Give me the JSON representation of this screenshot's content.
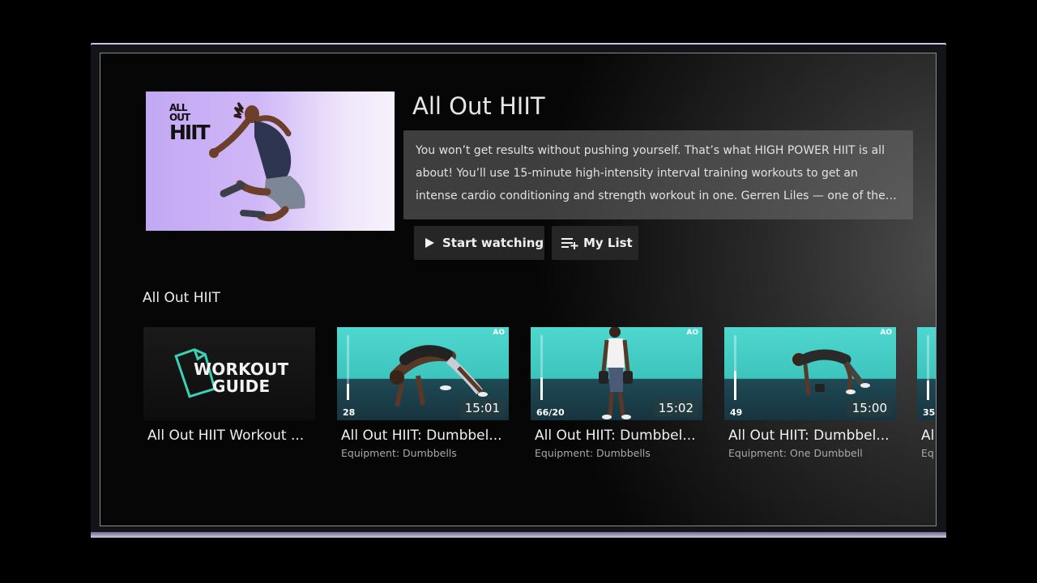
{
  "hero": {
    "logo_line1": "ALL OUT",
    "logo_line2": "HIIT",
    "title": "All Out HIIT",
    "description": "You won’t get results without pushing yourself. That’s what HIGH POWER HIIT is all about! You’ll use 15-minute high-intensity interval training workouts to get an intense cardio conditioning and strength workout in one. Gerren Liles — one of the most m...",
    "start_label": "Start watching",
    "mylist_label": "My List"
  },
  "row": {
    "title": "All Out HIIT",
    "cards": [
      {
        "title": "All Out HIIT Workout ...",
        "subtitle": "",
        "guide_line1": "WORKOUT",
        "guide_line2": "GUIDE"
      },
      {
        "title": "All Out HIIT: Dumbbel...",
        "subtitle": "Equipment: Dumbbells",
        "duration": "15:01",
        "number": "28",
        "meter_fraction": 0.25,
        "brand": "AO"
      },
      {
        "title": "All Out HIIT: Dumbbel...",
        "subtitle": "Equipment: Dumbbells",
        "duration": "15:02",
        "number": "66/20",
        "meter_fraction": 0.35,
        "brand": "AO"
      },
      {
        "title": "All Out HIIT: Dumbbel...",
        "subtitle": "Equipment: One Dumbbell",
        "duration": "15:00",
        "number": "49",
        "meter_fraction": 0.45,
        "brand": "AO"
      },
      {
        "title": "Al",
        "subtitle": "Eq",
        "number": "35",
        "meter_fraction": 0.3
      }
    ]
  },
  "colors": {
    "accent_teal": "#3cc4bd",
    "hero_purple": "#c2a8f4",
    "guide_icon": "#3ad1b5"
  },
  "icons": {
    "play": "play-icon",
    "mylist": "playlist-add-icon",
    "document": "document-icon"
  }
}
